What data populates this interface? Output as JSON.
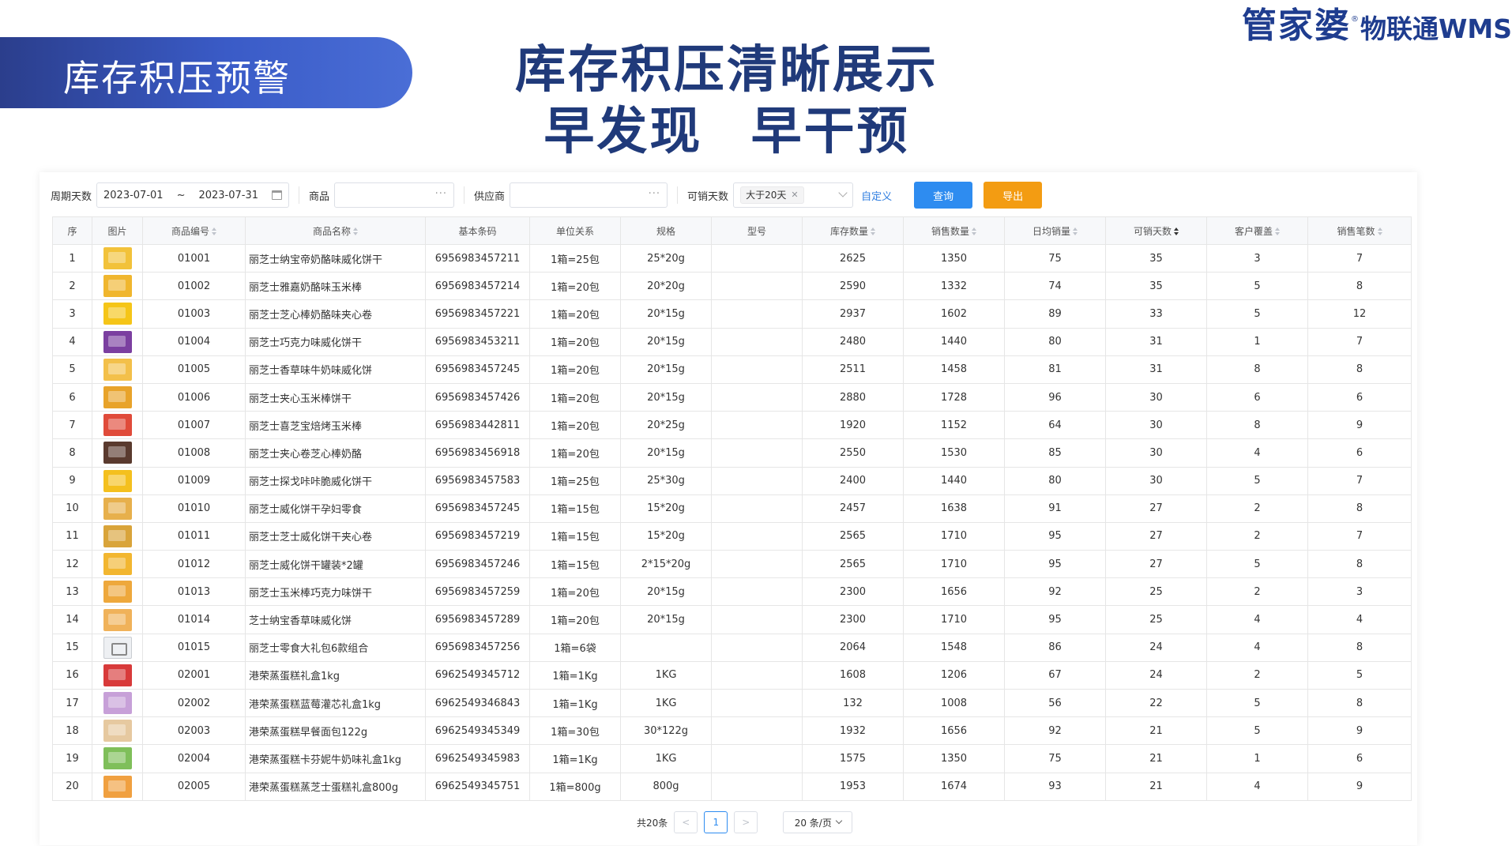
{
  "banner": {
    "title": "库存积压预警"
  },
  "headline": {
    "line1": "库存积压清晰展示",
    "line2": "早发现 早干预"
  },
  "logo": {
    "brand": "管家婆",
    "reg_mark": "®",
    "product": "物联通WMS",
    "color": "#1f3d8f"
  },
  "filters": {
    "period_label": "周期天数",
    "date_start": "2023-07-01",
    "date_sep": "~",
    "date_end": "2023-07-31",
    "product_label": "商品",
    "product_value": "",
    "supplier_label": "供应商",
    "supplier_value": "",
    "sellable_label": "可销天数",
    "sellable_tag": "大于20天",
    "custom_link": "自定义",
    "query_button": "查询",
    "export_button": "导出",
    "query_color": "#2e8cf0",
    "export_color": "#f39c12"
  },
  "table": {
    "columns": [
      "序",
      "图片",
      "商品编号",
      "商品名称",
      "基本条码",
      "单位关系",
      "规格",
      "型号",
      "库存数量",
      "销售数量",
      "日均销量",
      "可销天数",
      "客户覆盖",
      "销售笔数"
    ],
    "sorted_column": "可销天数",
    "rows": [
      {
        "no": "1",
        "img": "#f2c23a",
        "code": "01001",
        "name": "丽芝士纳宝帝奶酪味威化饼干",
        "barcode": "6956983457211",
        "unit": "1箱=25包",
        "spec": "25*20g",
        "model": "",
        "stock": "2625",
        "sales": "1350",
        "daily": "75",
        "days": "35",
        "cust": "3",
        "orders": "7"
      },
      {
        "no": "2",
        "img": "#f0b62e",
        "code": "01002",
        "name": "丽芝士雅嘉奶酪味玉米棒",
        "barcode": "6956983457214",
        "unit": "1箱=20包",
        "spec": "20*20g",
        "model": "",
        "stock": "2590",
        "sales": "1332",
        "daily": "74",
        "days": "35",
        "cust": "5",
        "orders": "8"
      },
      {
        "no": "3",
        "img": "#f5c518",
        "code": "01003",
        "name": "丽芝士芝心棒奶酪味夹心卷",
        "barcode": "6956983457221",
        "unit": "1箱=20包",
        "spec": "20*15g",
        "model": "",
        "stock": "2937",
        "sales": "1602",
        "daily": "89",
        "days": "33",
        "cust": "5",
        "orders": "12"
      },
      {
        "no": "4",
        "img": "#7b3fa0",
        "code": "01004",
        "name": "丽芝士巧克力味威化饼干",
        "barcode": "6956983453211",
        "unit": "1箱=20包",
        "spec": "20*15g",
        "model": "",
        "stock": "2480",
        "sales": "1440",
        "daily": "80",
        "days": "31",
        "cust": "1",
        "orders": "7"
      },
      {
        "no": "5",
        "img": "#f3c04a",
        "code": "01005",
        "name": "丽芝士香草味牛奶味威化饼",
        "barcode": "6956983457245",
        "unit": "1箱=20包",
        "spec": "20*15g",
        "model": "",
        "stock": "2511",
        "sales": "1458",
        "daily": "81",
        "days": "31",
        "cust": "8",
        "orders": "8"
      },
      {
        "no": "6",
        "img": "#e8a32a",
        "code": "01006",
        "name": "丽芝士夹心玉米棒饼干",
        "barcode": "6956983457426",
        "unit": "1箱=20包",
        "spec": "20*15g",
        "model": "",
        "stock": "2880",
        "sales": "1728",
        "daily": "96",
        "days": "30",
        "cust": "6",
        "orders": "6"
      },
      {
        "no": "7",
        "img": "#e04b3a",
        "code": "01007",
        "name": "丽芝士喜芝宝焙烤玉米棒",
        "barcode": "6956983442811",
        "unit": "1箱=20包",
        "spec": "20*25g",
        "model": "",
        "stock": "1920",
        "sales": "1152",
        "daily": "64",
        "days": "30",
        "cust": "8",
        "orders": "9"
      },
      {
        "no": "8",
        "img": "#5a3a2e",
        "code": "01008",
        "name": "丽芝士夹心卷芝心棒奶酪",
        "barcode": "6956983456918",
        "unit": "1箱=20包",
        "spec": "20*15g",
        "model": "",
        "stock": "2550",
        "sales": "1530",
        "daily": "85",
        "days": "30",
        "cust": "4",
        "orders": "6"
      },
      {
        "no": "9",
        "img": "#f4c01e",
        "code": "01009",
        "name": "丽芝士探戈咔咔脆威化饼干",
        "barcode": "6956983457583",
        "unit": "1箱=25包",
        "spec": "25*30g",
        "model": "",
        "stock": "2400",
        "sales": "1440",
        "daily": "80",
        "days": "30",
        "cust": "5",
        "orders": "7"
      },
      {
        "no": "10",
        "img": "#e7b04c",
        "code": "01010",
        "name": "丽芝士威化饼干孕妇零食",
        "barcode": "6956983457245",
        "unit": "1箱=15包",
        "spec": "15*20g",
        "model": "",
        "stock": "2457",
        "sales": "1638",
        "daily": "91",
        "days": "27",
        "cust": "2",
        "orders": "8"
      },
      {
        "no": "11",
        "img": "#d9a43a",
        "code": "01011",
        "name": "丽芝士芝士威化饼干夹心卷",
        "barcode": "6956983457219",
        "unit": "1箱=15包",
        "spec": "15*20g",
        "model": "",
        "stock": "2565",
        "sales": "1710",
        "daily": "95",
        "days": "27",
        "cust": "2",
        "orders": "7"
      },
      {
        "no": "12",
        "img": "#f2b630",
        "code": "01012",
        "name": "丽芝士威化饼干罐装*2罐",
        "barcode": "6956983457246",
        "unit": "1箱=15包",
        "spec": "2*15*20g",
        "model": "",
        "stock": "2565",
        "sales": "1710",
        "daily": "95",
        "days": "27",
        "cust": "5",
        "orders": "8"
      },
      {
        "no": "13",
        "img": "#eea83c",
        "code": "01013",
        "name": "丽芝士玉米棒巧克力味饼干",
        "barcode": "6956983457259",
        "unit": "1箱=20包",
        "spec": "20*15g",
        "model": "",
        "stock": "2300",
        "sales": "1656",
        "daily": "92",
        "days": "25",
        "cust": "2",
        "orders": "3"
      },
      {
        "no": "14",
        "img": "#f0b25a",
        "code": "01014",
        "name": "芝士纳宝香草味威化饼",
        "barcode": "6956983457289",
        "unit": "1箱=20包",
        "spec": "20*15g",
        "model": "",
        "stock": "2300",
        "sales": "1710",
        "daily": "95",
        "days": "25",
        "cust": "4",
        "orders": "4"
      },
      {
        "no": "15",
        "img": "",
        "code": "01015",
        "name": "丽芝士零食大礼包6款组合",
        "barcode": "6956983457256",
        "unit": "1箱=6袋",
        "spec": "",
        "model": "",
        "stock": "2064",
        "sales": "1548",
        "daily": "86",
        "days": "24",
        "cust": "4",
        "orders": "8"
      },
      {
        "no": "16",
        "img": "#d83a3a",
        "code": "02001",
        "name": "港荣蒸蛋糕礼盒1kg",
        "barcode": "6962549345712",
        "unit": "1箱=1Kg",
        "spec": "1KG",
        "model": "",
        "stock": "1608",
        "sales": "1206",
        "daily": "67",
        "days": "24",
        "cust": "2",
        "orders": "5"
      },
      {
        "no": "17",
        "img": "#c7a0d8",
        "code": "02002",
        "name": "港荣蒸蛋糕蓝莓灌芯礼盒1kg",
        "barcode": "6962549346843",
        "unit": "1箱=1Kg",
        "spec": "1KG",
        "model": "",
        "stock": "132",
        "sales": "1008",
        "daily": "56",
        "days": "22",
        "cust": "5",
        "orders": "8"
      },
      {
        "no": "18",
        "img": "#e6c9a0",
        "code": "02003",
        "name": "港荣蒸蛋糕早餐面包122g",
        "barcode": "6962549345349",
        "unit": "1箱=30包",
        "spec": "30*122g",
        "model": "",
        "stock": "1932",
        "sales": "1656",
        "daily": "92",
        "days": "21",
        "cust": "5",
        "orders": "9"
      },
      {
        "no": "19",
        "img": "#7fbf5a",
        "code": "02004",
        "name": "港荣蒸蛋糕卡芬妮牛奶味礼盒1kg",
        "barcode": "6962549345983",
        "unit": "1箱=1Kg",
        "spec": "1KG",
        "model": "",
        "stock": "1575",
        "sales": "1350",
        "daily": "75",
        "days": "21",
        "cust": "1",
        "orders": "6"
      },
      {
        "no": "20",
        "img": "#f0a040",
        "code": "02005",
        "name": "港荣蒸蛋糕蒸芝士蛋糕礼盒800g",
        "barcode": "6962549345751",
        "unit": "1箱=800g",
        "spec": "800g",
        "model": "",
        "stock": "1953",
        "sales": "1674",
        "daily": "93",
        "days": "21",
        "cust": "4",
        "orders": "9"
      }
    ]
  },
  "pagination": {
    "total": "共20条",
    "prev": "<",
    "current": "1",
    "next": ">",
    "page_size": "20 条/页"
  }
}
